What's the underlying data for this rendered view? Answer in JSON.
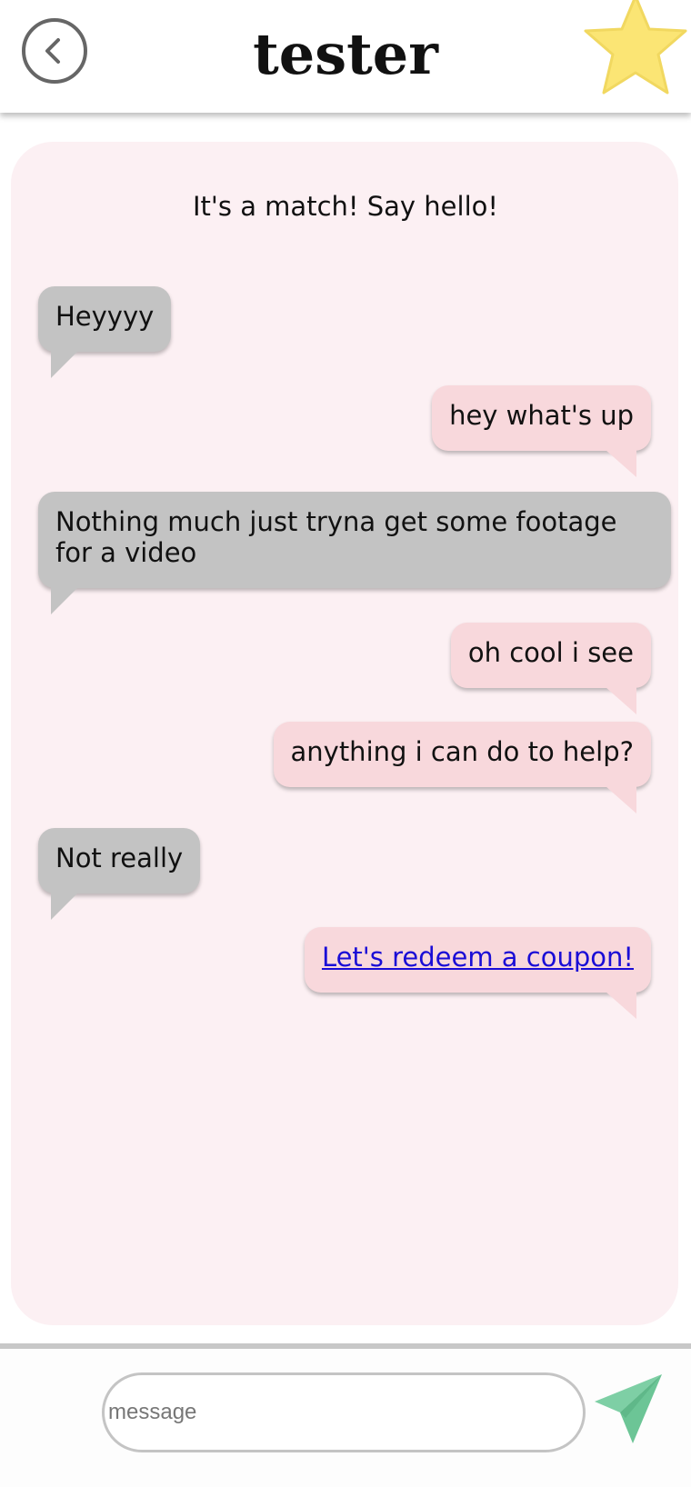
{
  "header": {
    "title": "tester",
    "back_icon": "back-chevron-icon",
    "favorite_icon": "star-icon",
    "star_color": "#fbe574"
  },
  "chat": {
    "match_note": "It's a match! Say hello!",
    "messages": [
      {
        "sender": "them",
        "text": "Heyyyy"
      },
      {
        "sender": "me",
        "text": "hey what's up"
      },
      {
        "sender": "them",
        "text": "Nothing much just tryna get some footage for a video"
      },
      {
        "sender": "me",
        "text": "oh cool i see"
      },
      {
        "sender": "me",
        "text": "anything i can do to help?"
      },
      {
        "sender": "them",
        "text": "Not really"
      },
      {
        "sender": "me",
        "text": "Let's redeem a coupon!",
        "is_link": true
      }
    ]
  },
  "composer": {
    "placeholder": "message",
    "value": "",
    "send_icon": "send-paper-plane-icon",
    "send_color": "#7ecfa5"
  },
  "colors": {
    "panel_background": "#fcf0f3",
    "their_bubble": "#c3c3c3",
    "my_bubble": "#f8d8dc",
    "link": "#1a0dd6"
  }
}
